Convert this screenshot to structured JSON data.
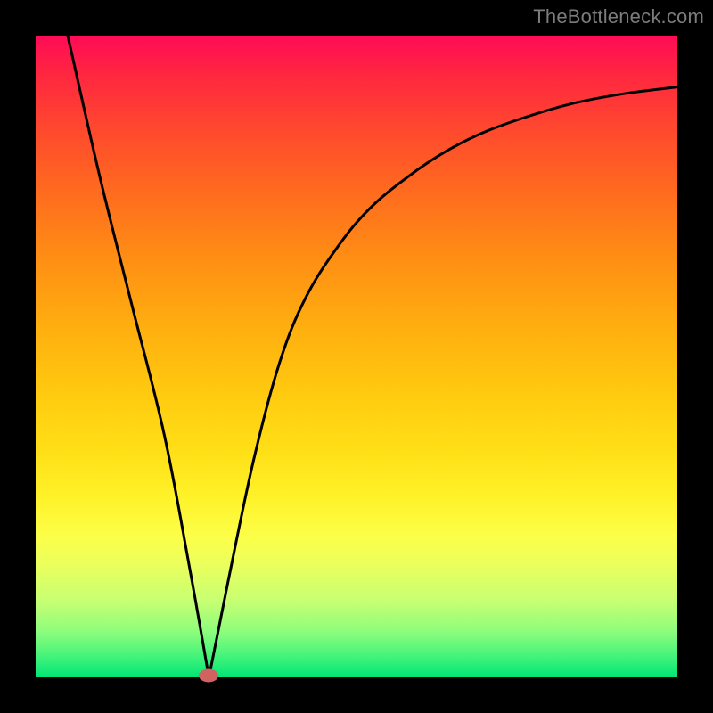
{
  "watermark": "TheBottleneck.com",
  "chart_data": {
    "type": "line",
    "title": "",
    "xlabel": "",
    "ylabel": "",
    "xlim": [
      0,
      100
    ],
    "ylim": [
      0,
      100
    ],
    "series": [
      {
        "name": "bottleneck-curve",
        "x": [
          5,
          10,
          15,
          20,
          24,
          27,
          30,
          34,
          38,
          42,
          47,
          52,
          58,
          64,
          70,
          77,
          84,
          92,
          100
        ],
        "values": [
          100,
          78,
          58,
          38,
          17,
          0,
          15,
          34,
          49,
          59,
          67,
          73,
          78,
          82,
          85,
          87.5,
          89.5,
          91,
          92
        ]
      }
    ],
    "marker": {
      "x": 27,
      "y": 0
    },
    "background_gradient": {
      "top": "#ff0b56",
      "bottom": "#00e676"
    }
  }
}
